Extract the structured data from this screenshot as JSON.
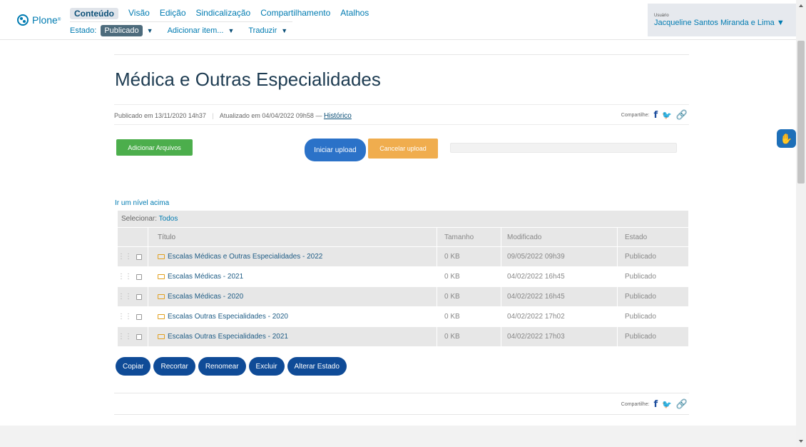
{
  "toolbar": {
    "logo": "Plone",
    "logo_mark": "®",
    "tabs": [
      "Conteúdo",
      "Visão",
      "Edição",
      "Sindicalização",
      "Compartilhamento",
      "Atalhos"
    ],
    "state_label": "Estado:",
    "state_value": "Publicado",
    "add_item": "Adicionar item...",
    "translate": "Traduzir",
    "user_label": "Usuário",
    "user_name": "Jacqueline Santos Miranda e Lima ▼"
  },
  "page": {
    "title": "Médica e Outras Especialidades",
    "published": "Publicado em 13/11/2020 14h37",
    "updated": "Atualizado em 04/04/2022 09h58",
    "history": "Histórico",
    "share_label": "Compartilhe:"
  },
  "upload": {
    "add_files": "Adicionar Arquivos",
    "start": "Iniciar upload",
    "cancel": "Cancelar upload"
  },
  "folder": {
    "up_link": "Ir um nível acima",
    "select_label": "Selecionar:",
    "select_all": "Todos",
    "columns": [
      "Título",
      "Tamanho",
      "Modificado",
      "Estado"
    ],
    "rows": [
      {
        "title": "Escalas Médicas e Outras Especialidades - 2022",
        "size": "0 KB",
        "modified": "09/05/2022 09h39",
        "state": "Publicado"
      },
      {
        "title": "Escalas Médicas - 2021",
        "size": "0 KB",
        "modified": "04/02/2022 16h45",
        "state": "Publicado"
      },
      {
        "title": "Escalas Médicas - 2020",
        "size": "0 KB",
        "modified": "04/02/2022 16h45",
        "state": "Publicado"
      },
      {
        "title": "Escalas Outras Especialidades - 2020",
        "size": "0 KB",
        "modified": "04/02/2022 17h02",
        "state": "Publicado"
      },
      {
        "title": "Escalas Outras Especialidades - 2021",
        "size": "0 KB",
        "modified": "04/02/2022 17h03",
        "state": "Publicado"
      }
    ]
  },
  "actions": [
    "Copiar",
    "Recortar",
    "Renomear",
    "Excluir",
    "Alterar Estado"
  ],
  "icons": {
    "facebook": "facebook-icon",
    "twitter": "twitter-icon",
    "link": "link-icon",
    "accessibility": "hand-sign-icon"
  }
}
